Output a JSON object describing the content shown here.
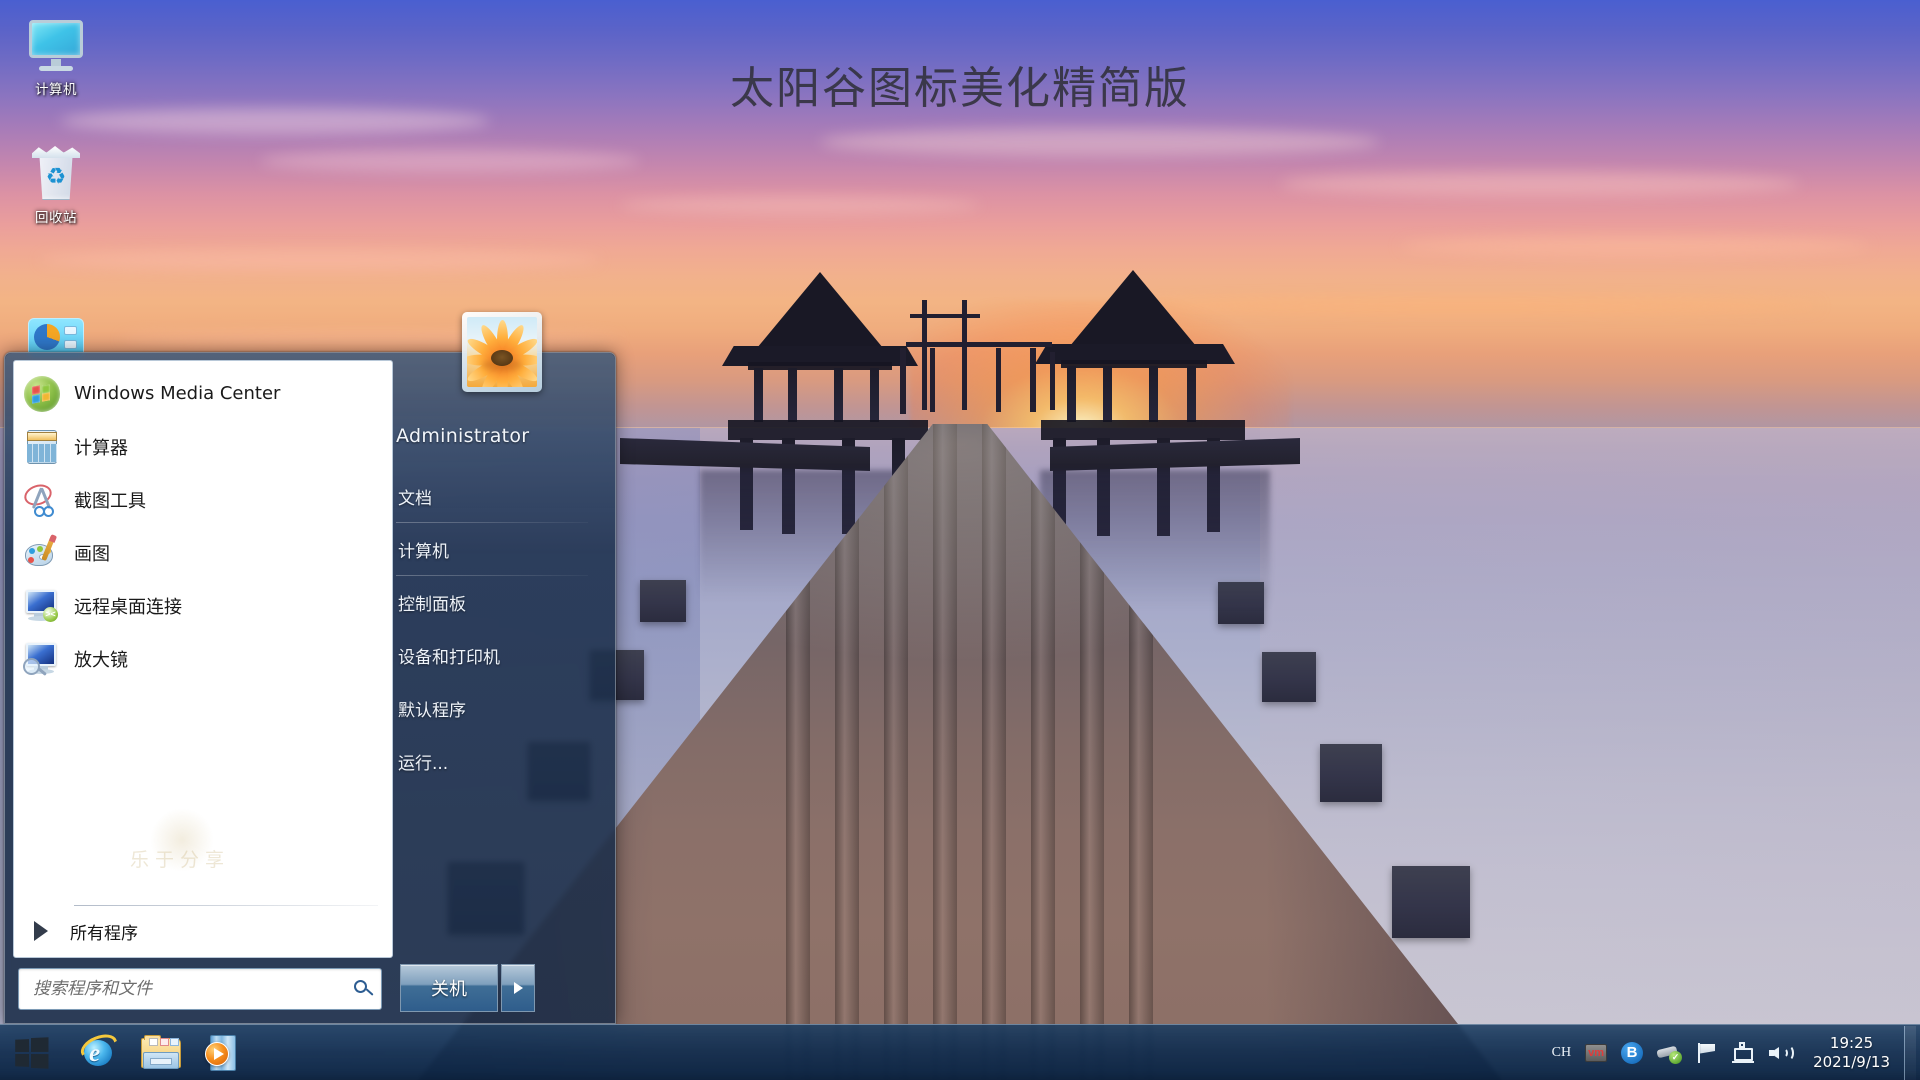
{
  "desktop": {
    "wallpaper_title": "太阳谷图标美化精简版",
    "icons": [
      {
        "label": "计算机",
        "icon": "computer-monitor-icon"
      },
      {
        "label": "回收站",
        "icon": "recycle-bin-icon"
      },
      {
        "label": "",
        "icon": "network-disk-icon"
      }
    ]
  },
  "start_menu": {
    "programs": [
      {
        "label": "Windows Media Center",
        "icon": "windows-media-center-icon"
      },
      {
        "label": "计算器",
        "icon": "calculator-icon"
      },
      {
        "label": "截图工具",
        "icon": "snipping-tool-icon"
      },
      {
        "label": "画图",
        "icon": "paint-icon"
      },
      {
        "label": "远程桌面连接",
        "icon": "remote-desktop-icon"
      },
      {
        "label": "放大镜",
        "icon": "magnifier-icon"
      }
    ],
    "all_programs_label": "所有程序",
    "search": {
      "placeholder": "搜索程序和文件",
      "value": "",
      "icon": "search-icon"
    },
    "watermark": "乐于分享",
    "user": {
      "name": "Administrator",
      "avatar": "flower-avatar"
    },
    "right_items": [
      {
        "label": "文档",
        "separator_after": true
      },
      {
        "label": "计算机",
        "separator_after": true
      },
      {
        "label": "控制面板",
        "separator_after": false
      },
      {
        "label": "设备和打印机",
        "separator_after": false
      },
      {
        "label": "默认程序",
        "separator_after": false
      },
      {
        "label": "运行...",
        "separator_after": false
      }
    ],
    "shutdown": {
      "label": "关机",
      "arrow_icon": "chevron-right-icon"
    }
  },
  "taskbar": {
    "start_button": "windows-logo-icon",
    "pinned": [
      {
        "name": "internet-explorer",
        "icon": "internet-explorer-icon"
      },
      {
        "name": "file-explorer",
        "icon": "folder-icon"
      },
      {
        "name": "windows-media-player",
        "icon": "media-player-icon"
      }
    ],
    "tray": {
      "language": "CH",
      "items": [
        {
          "name": "vmware-tray",
          "icon": "vm-icon",
          "label": "vm"
        },
        {
          "name": "bluetooth-tray",
          "icon": "bluetooth-icon"
        },
        {
          "name": "safely-remove-hardware",
          "icon": "usb-eject-icon"
        },
        {
          "name": "action-center",
          "icon": "flag-icon"
        },
        {
          "name": "network",
          "icon": "network-icon"
        },
        {
          "name": "volume",
          "icon": "speaker-icon"
        }
      ]
    },
    "clock": {
      "time": "19:25",
      "date": "2021/9/13"
    }
  },
  "colors": {
    "taskbar": "#10365c",
    "start_menu_right": "#1e2e48",
    "accent": "#2f5d8c",
    "text_light": "#eef3f9"
  }
}
